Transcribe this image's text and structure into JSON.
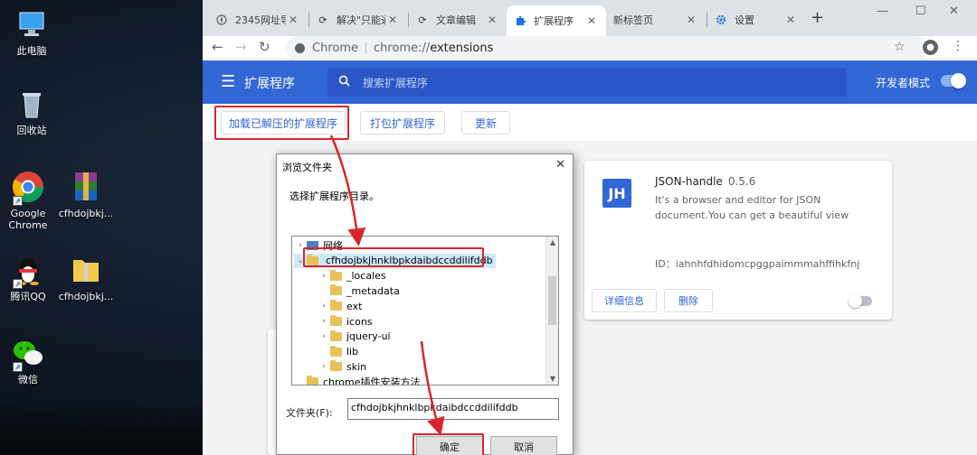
{
  "desktop": {
    "icons": [
      {
        "label": "此电脑"
      },
      {
        "label": "回收站"
      },
      {
        "label": "Google Chrome"
      },
      {
        "label": "cfhdojbkj..."
      },
      {
        "label": "腾讯QQ"
      },
      {
        "label": "cfhdojbkj..."
      },
      {
        "label": "微信"
      }
    ]
  },
  "browser": {
    "tabs": [
      {
        "label": "2345网址导",
        "icon": "compass-icon",
        "active": false
      },
      {
        "label": "解决\"只能通",
        "icon": "page-icon",
        "active": false
      },
      {
        "label": "文章编辑",
        "icon": "page-icon",
        "active": false
      },
      {
        "label": "扩展程序",
        "icon": "puzzle-icon",
        "active": true
      },
      {
        "label": "新标签页",
        "icon": "",
        "active": false
      },
      {
        "label": "设置",
        "icon": "gear-icon",
        "active": false
      }
    ],
    "omnibox": {
      "chip": "Chrome",
      "scheme": "chrome://",
      "host": "extensions"
    }
  },
  "extensions": {
    "title": "扩展程序",
    "search_placeholder": "搜索扩展程序",
    "dev_mode_label": "开发者模式",
    "dev_mode_on": true,
    "load_unpacked": "加载已解压的扩展程序",
    "pack": "打包扩展程序",
    "update": "更新",
    "card": {
      "icon_text": "JH",
      "name": "JSON-handle",
      "version": "0.5.6",
      "description": "It's a browser and editor for JSON document.You can get a beautiful view",
      "id_text": "ID：iahnhfdhidomcpggpaimmmahffihkfnj",
      "details": "详细信息",
      "remove": "删除",
      "enabled": false
    }
  },
  "dialog": {
    "title": "浏览文件夹",
    "prompt": "选择扩展程序目录。",
    "tree": [
      {
        "label": "网络",
        "type": "network",
        "level": 0,
        "arrow": "›",
        "selected": false
      },
      {
        "label": "cfhdojbkjhnklbpkdaibdccddilifddb",
        "type": "folder",
        "level": 0,
        "arrow": "⌄",
        "selected": true
      },
      {
        "label": "_locales",
        "type": "folder",
        "level": 1,
        "arrow": "›",
        "selected": false
      },
      {
        "label": "_metadata",
        "type": "folder",
        "level": 1,
        "arrow": "",
        "selected": false
      },
      {
        "label": "ext",
        "type": "folder",
        "level": 1,
        "arrow": "›",
        "selected": false
      },
      {
        "label": "icons",
        "type": "folder",
        "level": 1,
        "arrow": "›",
        "selected": false
      },
      {
        "label": "jquery-ui",
        "type": "folder",
        "level": 1,
        "arrow": "›",
        "selected": false
      },
      {
        "label": "lib",
        "type": "folder",
        "level": 1,
        "arrow": "",
        "selected": false
      },
      {
        "label": "skin",
        "type": "folder",
        "level": 1,
        "arrow": "›",
        "selected": false
      },
      {
        "label": "chrome插件安装方法",
        "type": "folder",
        "level": 0,
        "arrow": "",
        "selected": false
      }
    ],
    "folder_label": "文件夹(F):",
    "folder_value": "cfhdojbkjhnklbpkdaibdccddilifddb",
    "ok": "确定",
    "cancel": "取消"
  },
  "colors": {
    "accent": "#3367d6",
    "annotation": "#d9262e"
  }
}
